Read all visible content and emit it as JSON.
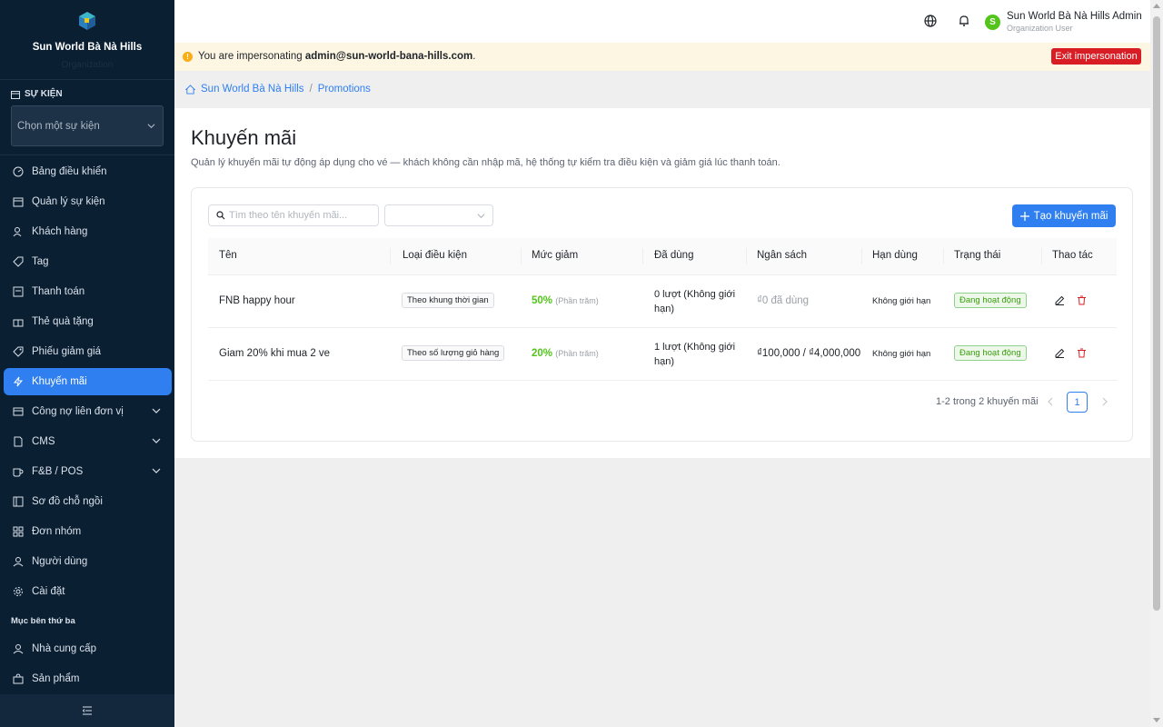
{
  "sidebar": {
    "org_name": "Sun World Bà Nà Hills",
    "org_sub": "Organization",
    "event_section": "SỰ KIỆN",
    "event_select_placeholder": "Chọn một sự kiện",
    "items": [
      {
        "label": "Bảng điều khiển",
        "icon": "dashboard-icon"
      },
      {
        "label": "Quản lý sự kiện",
        "icon": "calendar-icon"
      },
      {
        "label": "Khách hàng",
        "icon": "users-icon"
      },
      {
        "label": "Tag",
        "icon": "tag-icon"
      },
      {
        "label": "Thanh toán",
        "icon": "payment-icon"
      },
      {
        "label": "Thẻ quà tặng",
        "icon": "gift-icon"
      },
      {
        "label": "Phiếu giảm giá",
        "icon": "coupon-icon"
      },
      {
        "label": "Khuyến mãi",
        "icon": "lightning-icon",
        "active": true
      },
      {
        "label": "Công nợ liên đơn vị",
        "icon": "wallet-icon",
        "expandable": true
      },
      {
        "label": "CMS",
        "icon": "file-icon",
        "expandable": true
      },
      {
        "label": "F&B / POS",
        "icon": "coffee-icon",
        "expandable": true
      },
      {
        "label": "Sơ đồ chỗ ngồi",
        "icon": "layout-icon"
      },
      {
        "label": "Đơn nhóm",
        "icon": "grid-icon"
      },
      {
        "label": "Người dùng",
        "icon": "user-icon"
      },
      {
        "label": "Cài đặt",
        "icon": "gear-icon"
      }
    ],
    "third_party_label": "Mục bên thứ ba",
    "third_party_items": [
      {
        "label": "Nhà cung cấp",
        "icon": "user-icon"
      },
      {
        "label": "Sản phẩm",
        "icon": "bag-icon"
      }
    ]
  },
  "header": {
    "user_name": "Sun World Bà Nà Hills Admin",
    "user_role": "Organization User",
    "avatar_letter": "S"
  },
  "impersonation": {
    "prefix": "You are impersonating ",
    "email": "admin@sun-world-bana-hills.com",
    "suffix": ".",
    "exit_label": "Exit impersonation"
  },
  "breadcrumb": {
    "home": "Sun World Bà Nà Hills",
    "separator": "/",
    "current": "Promotions"
  },
  "page": {
    "title": "Khuyến mãi",
    "description": "Quản lý khuyến mãi tự động áp dụng cho vé — khách không cần nhập mã, hệ thống tự kiểm tra điều kiện và giảm giá lúc thanh toán.",
    "search_placeholder": "Tìm theo tên khuyến mãi...",
    "create_label": "Tạo khuyến mãi"
  },
  "table": {
    "columns": [
      "Tên",
      "Loại điều kiện",
      "Mức giảm",
      "Đã dùng",
      "Ngân sách",
      "Hạn dùng",
      "Trạng thái",
      "Thao tác"
    ],
    "rows": [
      {
        "name": "FNB happy hour",
        "condition": "Theo khung thời gian",
        "discount": "50%",
        "discount_type": "(Phần trăm)",
        "used": "0 lượt (Không giới hạn)",
        "budget": "₫0 đã dùng",
        "expiry": "Không giới hạn",
        "status": "Đang hoạt động"
      },
      {
        "name": "Giam 20% khi mua 2 ve",
        "condition": "Theo số lượng giỏ hàng",
        "discount": "20%",
        "discount_type": "(Phần trăm)",
        "used": "1 lượt (Không giới hạn)",
        "budget": "₫100,000 / ₫4,000,000",
        "expiry": "Không giới hạn",
        "status": "Đang hoạt động"
      }
    ]
  },
  "pagination": {
    "summary": "1-2 trong 2 khuyến mãi",
    "current_page": "1"
  },
  "colors": {
    "sidebar_bg": "#0b1f33",
    "accent": "#2f7ff0",
    "danger": "#d81e24",
    "success": "#52c41a"
  }
}
